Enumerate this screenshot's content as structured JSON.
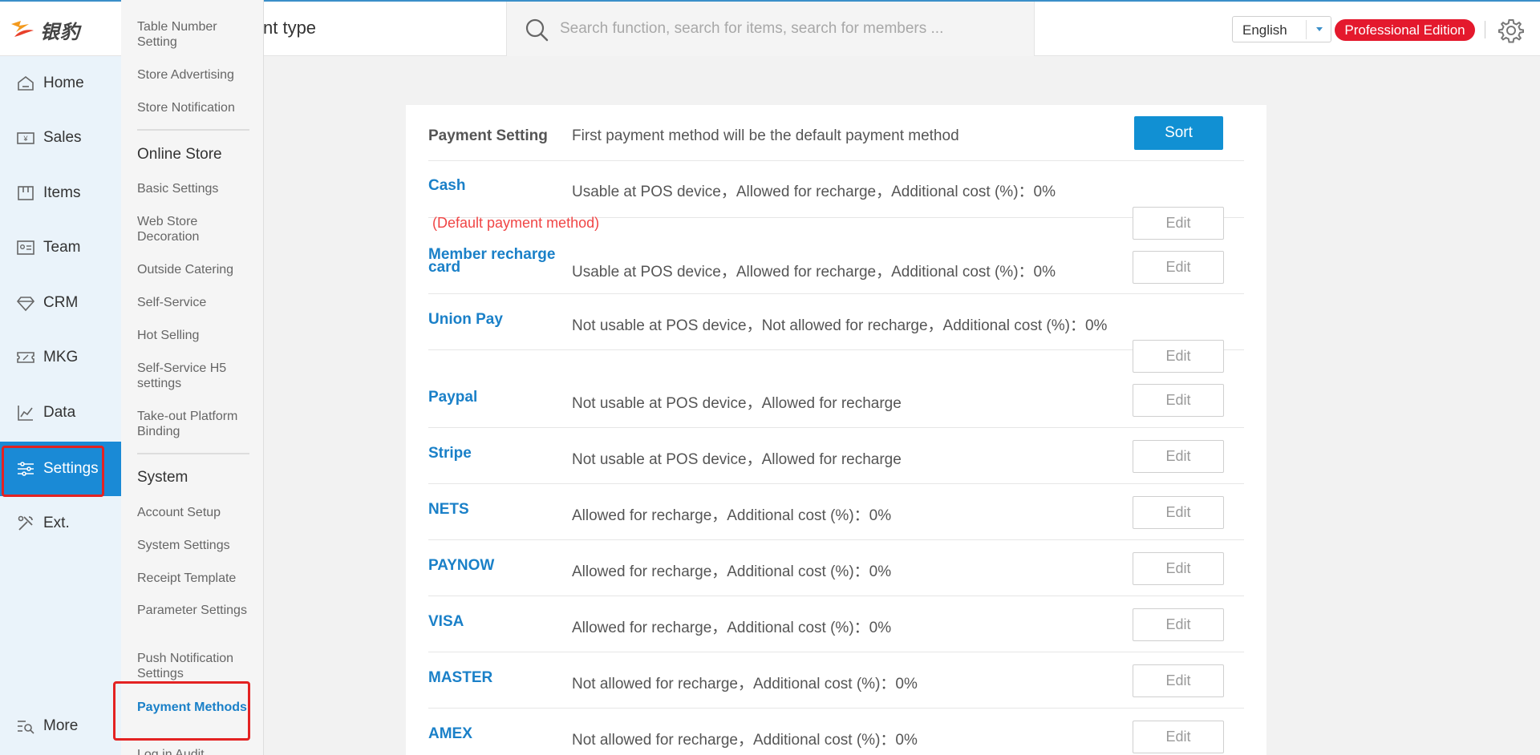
{
  "app": {
    "logo_text": "银豹",
    "page_title": "nt type"
  },
  "search": {
    "placeholder": "Search function, search for items, search for members ..."
  },
  "header": {
    "language": "English",
    "edition": "Professional Edition",
    "colors": {
      "accent": "#1a8ad6",
      "edition_badge": "#e4192d",
      "highlight_box": "#e32222"
    }
  },
  "nav": {
    "items": [
      {
        "label": "Home",
        "icon": "home-icon"
      },
      {
        "label": "Sales",
        "icon": "cash-icon"
      },
      {
        "label": "Items",
        "icon": "box-icon"
      },
      {
        "label": "Team",
        "icon": "id-card-icon"
      },
      {
        "label": "CRM",
        "icon": "diamond-icon"
      },
      {
        "label": "MKG",
        "icon": "ticket-icon"
      },
      {
        "label": "Data",
        "icon": "chart-icon"
      },
      {
        "label": "Settings",
        "icon": "sliders-icon"
      },
      {
        "label": "Ext.",
        "icon": "tools-icon"
      }
    ],
    "more_label": "More"
  },
  "submenu": {
    "top_items": [
      "Table Number Setting",
      "Store Advertising",
      "Store Notification"
    ],
    "online_store_heading": "Online Store",
    "online_store_items": [
      "Basic Settings",
      "Web Store Decoration",
      "Outside Catering",
      "Self-Service",
      "Hot Selling",
      "Self-Service H5 settings",
      "Take-out Platform Binding"
    ],
    "system_heading": "System",
    "system_items": [
      "Account Setup",
      "System Settings",
      "Receipt Template",
      "Parameter Settings",
      "Push Notification Settings",
      "Payment Methods",
      "Log in Audit"
    ]
  },
  "payment": {
    "title": "Payment Setting",
    "description": "First payment method will be the default payment method",
    "sort_label": "Sort",
    "edit_label": "Edit",
    "default_note": "(Default payment method)",
    "methods": [
      {
        "name": "Cash",
        "desc": "Usable at POS device，Allowed for recharge，Additional cost (%)：0%"
      },
      {
        "name": "Member recharge card",
        "desc": "Usable at POS device，Allowed for recharge，Additional cost (%)：0%"
      },
      {
        "name": "Union Pay",
        "desc": "Not usable at POS device，Not allowed for recharge，Additional cost (%)：0%"
      },
      {
        "name": "Paypal",
        "desc": "Not usable at POS device，Allowed for recharge"
      },
      {
        "name": "Stripe",
        "desc": "Not usable at POS device，Allowed for recharge"
      },
      {
        "name": "NETS",
        "desc": "Allowed for recharge，Additional cost (%)：0%"
      },
      {
        "name": "PAYNOW",
        "desc": "Allowed for recharge，Additional cost (%)：0%"
      },
      {
        "name": "VISA",
        "desc": "Allowed for recharge，Additional cost (%)：0%"
      },
      {
        "name": "MASTER",
        "desc": "Not allowed for recharge，Additional cost (%)：0%"
      },
      {
        "name": "AMEX",
        "desc": "Not allowed for recharge，Additional cost (%)：0%"
      }
    ]
  }
}
